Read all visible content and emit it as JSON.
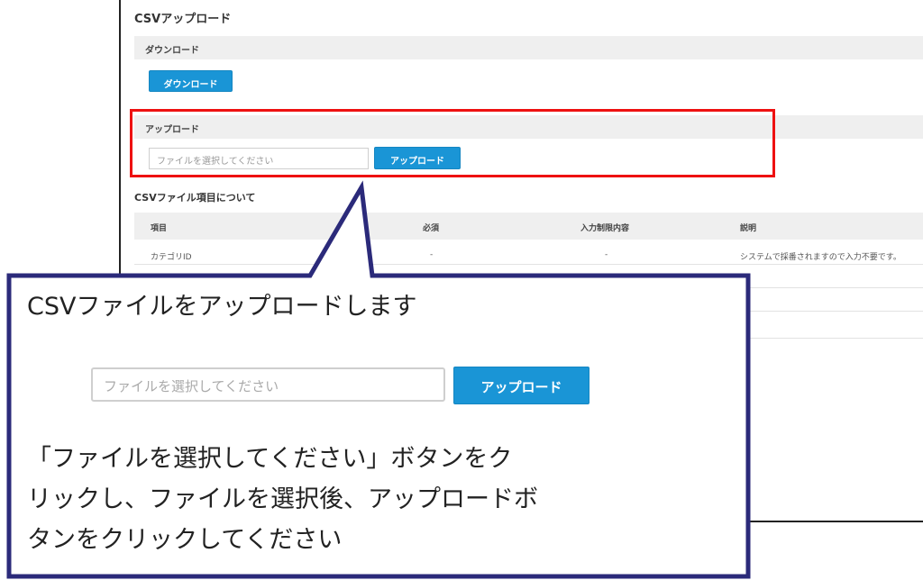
{
  "page": {
    "title": "CSVアップロード"
  },
  "download_section": {
    "label": "ダウンロード",
    "button_label": "ダウンロード"
  },
  "upload_section": {
    "label": "アップロード",
    "file_placeholder": "ファイルを選択してください",
    "button_label": "アップロード"
  },
  "csv_items": {
    "title": "CSVファイル項目について",
    "columns": [
      "項目",
      "必須",
      "入力制限内容",
      "説明"
    ],
    "rows": [
      {
        "item": "カテゴリID",
        "required": "-",
        "restriction": "-",
        "description": "システムで採番されますので入力不要です。"
      }
    ]
  },
  "callout": {
    "heading": "CSVファイルをアップロードします",
    "file_placeholder": "ファイルを選択してください",
    "button_label": "アップロード",
    "instruction_lines": [
      "「ファイルを選択してください」ボタンをク",
      "リックし、ファイルを選択後、アップロードボ",
      "タンをクリックしてください"
    ]
  },
  "colors": {
    "accent": "#1a95d6",
    "highlight": "#ee1111",
    "callout_border": "#2b2a7a"
  }
}
